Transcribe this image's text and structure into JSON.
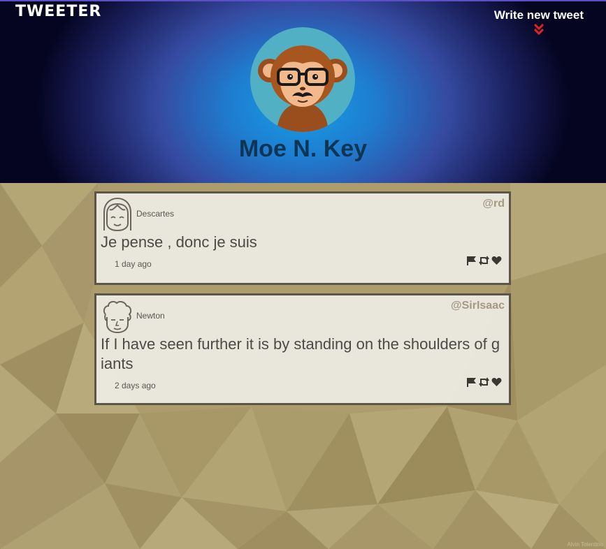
{
  "header": {
    "logo": "TWEETER",
    "compose_label": "Write new tweet",
    "compose_icon": "double-chevron-down-icon",
    "accent_color": "#e02424",
    "user_name": "Moe N. Key"
  },
  "tweets": [
    {
      "author": "Descartes",
      "handle": "@rd",
      "text": "Je pense , donc je suis",
      "time": "1 day ago"
    },
    {
      "author": "Newton",
      "handle": "@SirIsaac",
      "text": "If I have seen further it is by standing on the shoulders of giants",
      "time": "2 days ago"
    }
  ],
  "icons": {
    "flag": "flag-icon",
    "retweet": "retweet-icon",
    "like": "heart-icon"
  }
}
